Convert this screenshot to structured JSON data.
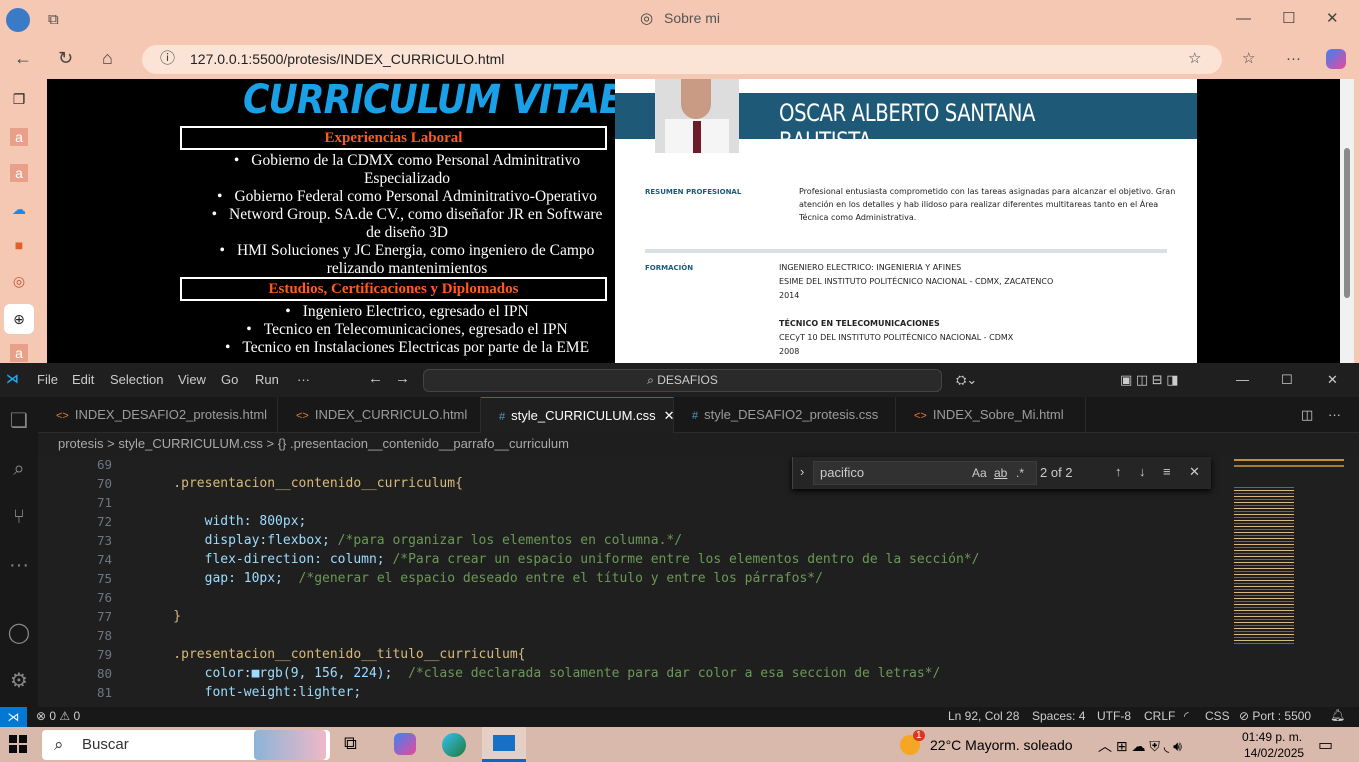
{
  "browser": {
    "tab_title": "Sobre mi",
    "url": "127.0.0.1:5500/protesis/INDEX_CURRICULO.html"
  },
  "cv": {
    "title": "CURRICULUM VITAE",
    "section1": "Experiencias Laboral",
    "exp": [
      "Gobierno de la CDMX como Personal Adminitrativo Especializado",
      "Gobierno Federal como Personal Adminitrativo-Operativo",
      "Netword Group. SA.de CV., como diseñafor JR en Software de diseño 3D",
      "HMI Soluciones y JC Energia, como ingeniero de Campo relizando mantenimientos"
    ],
    "section2": "Estudios, Certificaciones y Diplomados",
    "edu": [
      "Ingeniero Electrico, egresado el IPN",
      "Tecnico en Telecomunicaciones, egresado el IPN",
      "Tecnico en Instalaciones Electricas por parte de la EME"
    ]
  },
  "resume": {
    "name": "OSCAR ALBERTO SANTANA BAUTISTA",
    "profile_label": "RESUMEN PROFESIONAL",
    "profile_text": "Profesional entusiasta comprometido con las tareas asignadas para alcanzar el objetivo. Gran atención en los detalles y hab ilidoso para realizar diferentes multitareas tanto en el Área Técnica como Administrativa.",
    "formacion_label": "FORMACIÓN",
    "deg1": "INGENIERO ELECTRICO: INGENIERIA Y AFINES",
    "school1": "ESIME DEL INSTITUTO POLITÉCNICO NACIONAL - CDMX, ZACATENCO",
    "year1": "2014",
    "deg2": "TÉCNICO EN TELECOMUNICACIONES",
    "school2": "CECyT 10 DEL INSTITUTO POLITÉCNICO NACIONAL - CDMX",
    "year2": "2008"
  },
  "vscode": {
    "menu": [
      "File",
      "Edit",
      "Selection",
      "View",
      "Go",
      "Run",
      "···"
    ],
    "search": "DESAFIOS",
    "tabs": [
      "INDEX_DESAFIO2_protesis.html",
      "INDEX_CURRICULO.html",
      "style_CURRICULUM.css",
      "style_DESAFIO2_protesis.css",
      "INDEX_Sobre_Mi.html"
    ],
    "crumbs": [
      "protesis",
      ">",
      "style_CURRICULUM.css",
      ">",
      "{} .presentacion__contenido__parrafo__curriculum"
    ],
    "find": {
      "query": "pacifico",
      "count": "2 of 2",
      "aa": "Aa",
      "ab": "ab",
      "regex": ".*"
    },
    "lines": [
      {
        "n": "69",
        "t": ""
      },
      {
        "n": "70",
        "t": "    .presentacion__contenido__curriculum{"
      },
      {
        "n": "71",
        "t": ""
      },
      {
        "n": "72",
        "t": "        width: 800px;"
      },
      {
        "n": "73",
        "t": "        display:flexbox; /*para organizar los elementos en columna.*/"
      },
      {
        "n": "74",
        "t": "        flex-direction: column; /*Para crear un espacio uniforme entre los elementos dentro de la sección*/"
      },
      {
        "n": "75",
        "t": "        gap: 10px;  /*generar el espacio deseado entre el título y entre los párrafos*/"
      },
      {
        "n": "76",
        "t": ""
      },
      {
        "n": "77",
        "t": "    }"
      },
      {
        "n": "78",
        "t": ""
      },
      {
        "n": "79",
        "t": "    .presentacion__contenido__titulo__curriculum{"
      },
      {
        "n": "80",
        "t": "        color:■rgb(9, 156, 224);  /*clase declarada solamente para dar color a esa seccion de letras*/"
      },
      {
        "n": "81",
        "t": "        font-weight:lighter;"
      }
    ],
    "status": {
      "problems": "⊗ 0 ⚠ 0",
      "pos": "Ln 92, Col 28",
      "spaces": "Spaces: 4",
      "enc": "UTF-8",
      "eol": "CRLF",
      "lang": "CSS",
      "port": "⊘ Port : 5500"
    }
  },
  "taskbar": {
    "search": "Buscar",
    "weather": "22°C  Mayorm. soleado",
    "time": "01:49 p. m.",
    "date": "14/02/2025",
    "badge": "1"
  }
}
